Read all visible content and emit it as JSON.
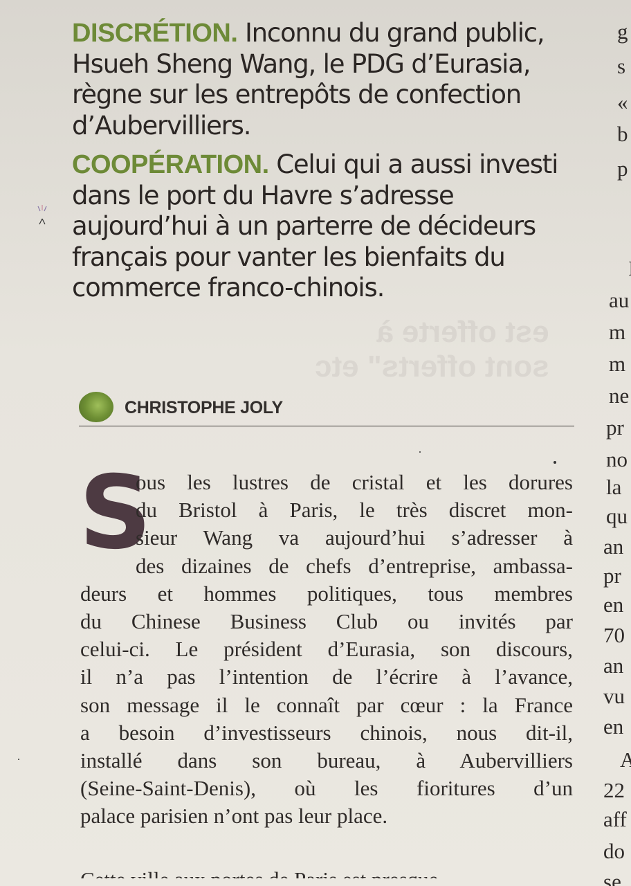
{
  "deck": {
    "p1_keyword": "DISCRÉTION.",
    "p1_text": "Inconnu du grand public, Hsueh Sheng Wang, le PDG d’Eurasia, règne sur les entrepôts de confection d’Aubervilliers.",
    "p2_keyword": "COOPÉRATION.",
    "p2_text": "Celui qui a aussi investi dans le port du Havre s’adresse aujourd’hui à un parterre de décideurs français pour vanter les bienfaits du commerce franco-chinois."
  },
  "byline": {
    "author": "CHRISTOPHE JOLY"
  },
  "article": {
    "dropcap": "S",
    "lines": [
      "ous les lustres de cristal et les dorures",
      "du Bristol à Paris, le très discret mon-",
      "sieur Wang va aujourd’hui s’adresser à",
      "des dizaines de chefs d’entreprise, ambassa-",
      "deurs et hommes politiques, tous membres",
      "du Chinese Business Club ou invités par",
      "celui-ci. Le président d’Eurasia, son discours,",
      "il n’a pas l’intention de l’écrire à l’avance,",
      "son message il le connaît par cœur : la France",
      "a besoin d’investisseurs chinois, nous dit-il,",
      "installé dans son bureau, à Aubervilliers",
      "(Seine-Saint-Denis), où les fioritures d’un",
      "palace parisien n’ont pas leur place.",
      "Cette ville aux portes de Paris est presque"
    ]
  },
  "right_column": {
    "fragments": [
      "g",
      "s",
      "«",
      "b",
      "p",
      "I",
      "au",
      "m",
      "m",
      "ne",
      "pr",
      "no",
      "la",
      "qu",
      "an",
      "pr",
      "en",
      "70",
      "an",
      "vu",
      "en",
      "A",
      "22",
      "aff",
      "do",
      "se"
    ]
  },
  "show_through": {
    "line1": "est offerte à",
    "line2": "sont offerts\" etc"
  }
}
